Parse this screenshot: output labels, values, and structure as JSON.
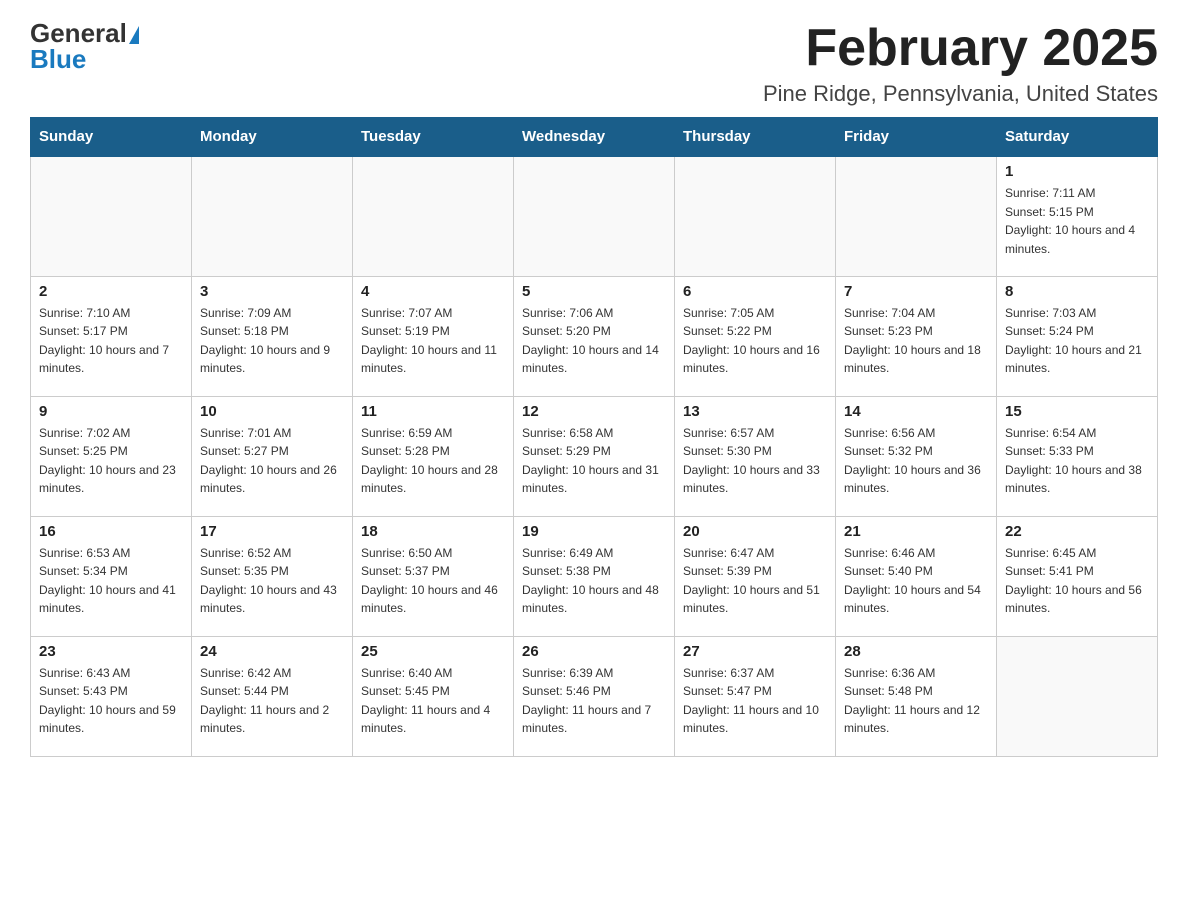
{
  "logo": {
    "general": "General",
    "blue": "Blue"
  },
  "title": "February 2025",
  "location": "Pine Ridge, Pennsylvania, United States",
  "days_of_week": [
    "Sunday",
    "Monday",
    "Tuesday",
    "Wednesday",
    "Thursday",
    "Friday",
    "Saturday"
  ],
  "weeks": [
    [
      {
        "day": "",
        "info": ""
      },
      {
        "day": "",
        "info": ""
      },
      {
        "day": "",
        "info": ""
      },
      {
        "day": "",
        "info": ""
      },
      {
        "day": "",
        "info": ""
      },
      {
        "day": "",
        "info": ""
      },
      {
        "day": "1",
        "info": "Sunrise: 7:11 AM\nSunset: 5:15 PM\nDaylight: 10 hours and 4 minutes."
      }
    ],
    [
      {
        "day": "2",
        "info": "Sunrise: 7:10 AM\nSunset: 5:17 PM\nDaylight: 10 hours and 7 minutes."
      },
      {
        "day": "3",
        "info": "Sunrise: 7:09 AM\nSunset: 5:18 PM\nDaylight: 10 hours and 9 minutes."
      },
      {
        "day": "4",
        "info": "Sunrise: 7:07 AM\nSunset: 5:19 PM\nDaylight: 10 hours and 11 minutes."
      },
      {
        "day": "5",
        "info": "Sunrise: 7:06 AM\nSunset: 5:20 PM\nDaylight: 10 hours and 14 minutes."
      },
      {
        "day": "6",
        "info": "Sunrise: 7:05 AM\nSunset: 5:22 PM\nDaylight: 10 hours and 16 minutes."
      },
      {
        "day": "7",
        "info": "Sunrise: 7:04 AM\nSunset: 5:23 PM\nDaylight: 10 hours and 18 minutes."
      },
      {
        "day": "8",
        "info": "Sunrise: 7:03 AM\nSunset: 5:24 PM\nDaylight: 10 hours and 21 minutes."
      }
    ],
    [
      {
        "day": "9",
        "info": "Sunrise: 7:02 AM\nSunset: 5:25 PM\nDaylight: 10 hours and 23 minutes."
      },
      {
        "day": "10",
        "info": "Sunrise: 7:01 AM\nSunset: 5:27 PM\nDaylight: 10 hours and 26 minutes."
      },
      {
        "day": "11",
        "info": "Sunrise: 6:59 AM\nSunset: 5:28 PM\nDaylight: 10 hours and 28 minutes."
      },
      {
        "day": "12",
        "info": "Sunrise: 6:58 AM\nSunset: 5:29 PM\nDaylight: 10 hours and 31 minutes."
      },
      {
        "day": "13",
        "info": "Sunrise: 6:57 AM\nSunset: 5:30 PM\nDaylight: 10 hours and 33 minutes."
      },
      {
        "day": "14",
        "info": "Sunrise: 6:56 AM\nSunset: 5:32 PM\nDaylight: 10 hours and 36 minutes."
      },
      {
        "day": "15",
        "info": "Sunrise: 6:54 AM\nSunset: 5:33 PM\nDaylight: 10 hours and 38 minutes."
      }
    ],
    [
      {
        "day": "16",
        "info": "Sunrise: 6:53 AM\nSunset: 5:34 PM\nDaylight: 10 hours and 41 minutes."
      },
      {
        "day": "17",
        "info": "Sunrise: 6:52 AM\nSunset: 5:35 PM\nDaylight: 10 hours and 43 minutes."
      },
      {
        "day": "18",
        "info": "Sunrise: 6:50 AM\nSunset: 5:37 PM\nDaylight: 10 hours and 46 minutes."
      },
      {
        "day": "19",
        "info": "Sunrise: 6:49 AM\nSunset: 5:38 PM\nDaylight: 10 hours and 48 minutes."
      },
      {
        "day": "20",
        "info": "Sunrise: 6:47 AM\nSunset: 5:39 PM\nDaylight: 10 hours and 51 minutes."
      },
      {
        "day": "21",
        "info": "Sunrise: 6:46 AM\nSunset: 5:40 PM\nDaylight: 10 hours and 54 minutes."
      },
      {
        "day": "22",
        "info": "Sunrise: 6:45 AM\nSunset: 5:41 PM\nDaylight: 10 hours and 56 minutes."
      }
    ],
    [
      {
        "day": "23",
        "info": "Sunrise: 6:43 AM\nSunset: 5:43 PM\nDaylight: 10 hours and 59 minutes."
      },
      {
        "day": "24",
        "info": "Sunrise: 6:42 AM\nSunset: 5:44 PM\nDaylight: 11 hours and 2 minutes."
      },
      {
        "day": "25",
        "info": "Sunrise: 6:40 AM\nSunset: 5:45 PM\nDaylight: 11 hours and 4 minutes."
      },
      {
        "day": "26",
        "info": "Sunrise: 6:39 AM\nSunset: 5:46 PM\nDaylight: 11 hours and 7 minutes."
      },
      {
        "day": "27",
        "info": "Sunrise: 6:37 AM\nSunset: 5:47 PM\nDaylight: 11 hours and 10 minutes."
      },
      {
        "day": "28",
        "info": "Sunrise: 6:36 AM\nSunset: 5:48 PM\nDaylight: 11 hours and 12 minutes."
      },
      {
        "day": "",
        "info": ""
      }
    ]
  ]
}
